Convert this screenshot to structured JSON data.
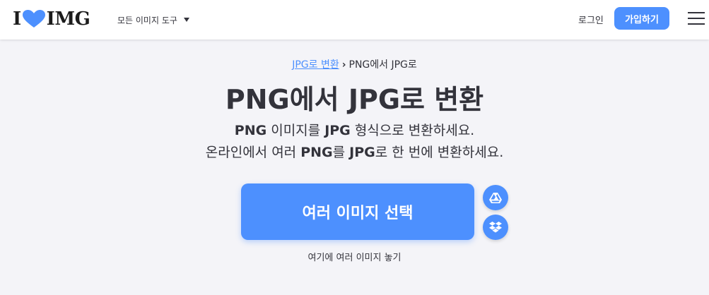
{
  "header": {
    "logo": {
      "left": "I",
      "right": "IMG"
    },
    "tools_menu": "모든 이미지 도구",
    "login": "로그인",
    "signup": "가입하기"
  },
  "breadcrumb": {
    "parent": "JPG로 변환",
    "current": "PNG에서 JPG로"
  },
  "title": "PNG에서 JPG로 변환",
  "subtitle": {
    "line1": {
      "b1": "PNG",
      "t1": " 이미지를 ",
      "b2": "JPG",
      "t2": " 형식으로 변환하세요."
    },
    "line2": {
      "t1": "온라인에서 여러 ",
      "b1": "PNG",
      "t2": "를 ",
      "b2": "JPG",
      "t3": "로 한 번에 변환하세요."
    }
  },
  "upload": {
    "select_button": "여러 이미지 선택",
    "drop_hint": "여기에 여러 이미지 놓기"
  },
  "icons": {
    "logo_heart": "heart-icon",
    "tools_caret": "caret-down-icon",
    "menu": "hamburger-menu-icon",
    "google_drive": "google-drive-icon",
    "dropbox": "dropbox-icon"
  },
  "colors": {
    "accent": "#4d90fe",
    "text": "#33333b",
    "background": "#f4f4f8",
    "header": "#ffffff"
  }
}
